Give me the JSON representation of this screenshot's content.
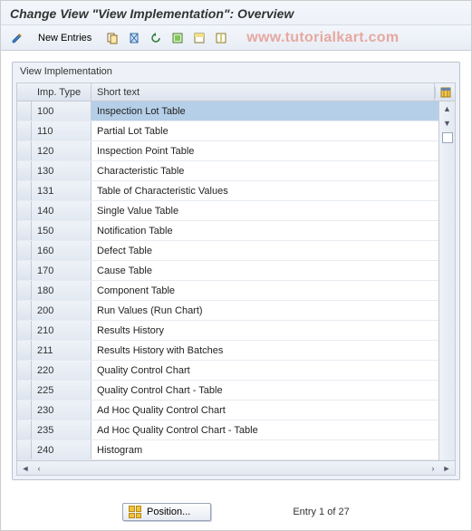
{
  "title": "Change View \"View Implementation\": Overview",
  "toolbar": {
    "new_entries": "New Entries"
  },
  "watermark": "www.tutorialkart.com",
  "panel": {
    "title": "View Implementation",
    "col_imp": "Imp. Type",
    "col_txt": "Short text"
  },
  "rows": [
    {
      "imp": "100",
      "txt": "Inspection Lot Table",
      "sel": true
    },
    {
      "imp": "110",
      "txt": "Partial Lot Table"
    },
    {
      "imp": "120",
      "txt": "Inspection Point Table"
    },
    {
      "imp": "130",
      "txt": "Characteristic Table"
    },
    {
      "imp": "131",
      "txt": "Table of Characteristic Values"
    },
    {
      "imp": "140",
      "txt": "Single Value Table"
    },
    {
      "imp": "150",
      "txt": "Notification Table"
    },
    {
      "imp": "160",
      "txt": "Defect Table"
    },
    {
      "imp": "170",
      "txt": "Cause Table"
    },
    {
      "imp": "180",
      "txt": "Component Table"
    },
    {
      "imp": "200",
      "txt": "Run Values (Run Chart)"
    },
    {
      "imp": "210",
      "txt": "Results History"
    },
    {
      "imp": "211",
      "txt": "Results History with Batches"
    },
    {
      "imp": "220",
      "txt": "Quality Control Chart"
    },
    {
      "imp": "225",
      "txt": "Quality Control Chart - Table"
    },
    {
      "imp": "230",
      "txt": "Ad Hoc Quality Control Chart"
    },
    {
      "imp": "235",
      "txt": "Ad Hoc Quality Control Chart - Table"
    },
    {
      "imp": "240",
      "txt": "Histogram"
    }
  ],
  "footer": {
    "position_btn": "Position...",
    "entry_text": "Entry 1 of 27"
  }
}
